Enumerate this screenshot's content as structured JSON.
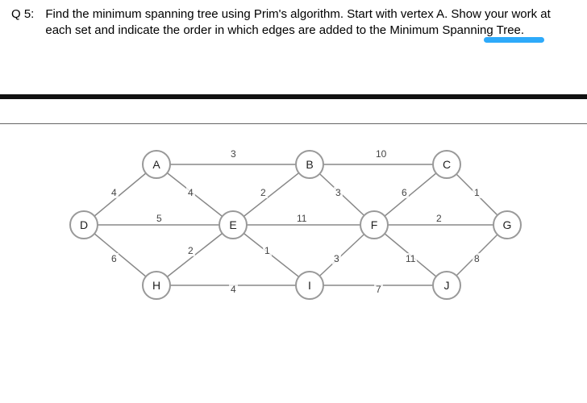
{
  "question": {
    "label": "Q 5:",
    "text": "Find the minimum spanning tree using Prim's algorithm. Start with vertex A. Show your work at each set and indicate the order in which edges are added to the Minimum Spanning Tree."
  },
  "graph": {
    "nodes": {
      "A": "A",
      "B": "B",
      "C": "C",
      "D": "D",
      "E": "E",
      "F": "F",
      "G": "G",
      "H": "H",
      "I": "I",
      "J": "J"
    },
    "edges": [
      {
        "u": "A",
        "v": "B",
        "w": "3"
      },
      {
        "u": "B",
        "v": "C",
        "w": "10"
      },
      {
        "u": "A",
        "v": "D",
        "w": "4"
      },
      {
        "u": "A",
        "v": "E",
        "w": "4"
      },
      {
        "u": "B",
        "v": "E",
        "w": "2"
      },
      {
        "u": "B",
        "v": "F",
        "w": "3"
      },
      {
        "u": "C",
        "v": "F",
        "w": "6"
      },
      {
        "u": "C",
        "v": "G",
        "w": "1"
      },
      {
        "u": "D",
        "v": "E",
        "w": "5"
      },
      {
        "u": "E",
        "v": "F",
        "w": "11"
      },
      {
        "u": "F",
        "v": "G",
        "w": "2"
      },
      {
        "u": "D",
        "v": "H",
        "w": "6"
      },
      {
        "u": "E",
        "v": "H",
        "w": "2"
      },
      {
        "u": "E",
        "v": "I",
        "w": "1"
      },
      {
        "u": "F",
        "v": "I",
        "w": "3"
      },
      {
        "u": "F",
        "v": "J",
        "w": "11"
      },
      {
        "u": "G",
        "v": "J",
        "w": "8"
      },
      {
        "u": "H",
        "v": "I",
        "w": "4"
      },
      {
        "u": "I",
        "v": "J",
        "w": "7"
      }
    ]
  },
  "chart_data": {
    "type": "graph",
    "title": "Weighted undirected graph for Prim's MST",
    "vertices": [
      "A",
      "B",
      "C",
      "D",
      "E",
      "F",
      "G",
      "H",
      "I",
      "J"
    ],
    "edges": [
      [
        "A",
        "B",
        3
      ],
      [
        "B",
        "C",
        10
      ],
      [
        "A",
        "D",
        4
      ],
      [
        "A",
        "E",
        4
      ],
      [
        "B",
        "E",
        2
      ],
      [
        "B",
        "F",
        3
      ],
      [
        "C",
        "F",
        6
      ],
      [
        "C",
        "G",
        1
      ],
      [
        "D",
        "E",
        5
      ],
      [
        "E",
        "F",
        11
      ],
      [
        "F",
        "G",
        2
      ],
      [
        "D",
        "H",
        6
      ],
      [
        "E",
        "H",
        2
      ],
      [
        "E",
        "I",
        1
      ],
      [
        "F",
        "I",
        3
      ],
      [
        "F",
        "J",
        11
      ],
      [
        "G",
        "J",
        8
      ],
      [
        "H",
        "I",
        4
      ],
      [
        "I",
        "J",
        7
      ]
    ]
  }
}
